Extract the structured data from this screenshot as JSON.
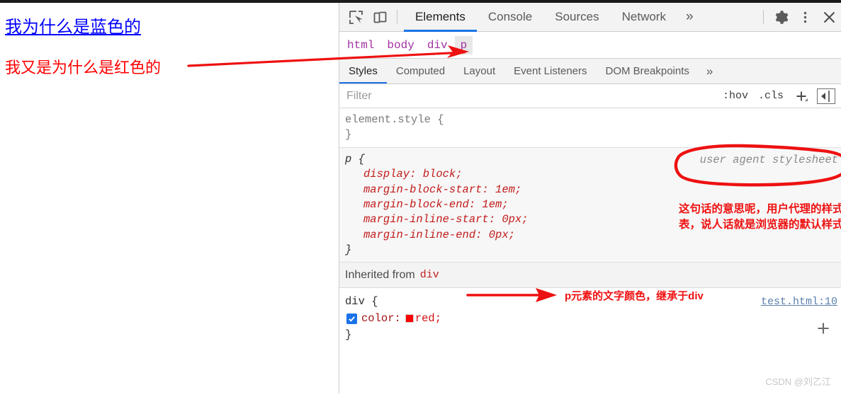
{
  "page": {
    "link_text": "我为什么是蓝色的",
    "paragraph_text": "我又是为什么是红色的",
    "link_color": "#0000ff",
    "paragraph_color": "#ff0000"
  },
  "devtools": {
    "toolbar": {
      "inspect_icon": "inspect-element-icon",
      "device_icon": "device-toolbar-icon",
      "settings_icon": "gear-icon",
      "menu_icon": "kebab-menu-icon",
      "close_icon": "close-icon",
      "more_label": "»",
      "tabs": [
        {
          "label": "Elements",
          "active": true
        },
        {
          "label": "Console",
          "active": false
        },
        {
          "label": "Sources",
          "active": false
        },
        {
          "label": "Network",
          "active": false
        }
      ]
    },
    "breadcrumb": {
      "items": [
        {
          "label": "html",
          "selected": false
        },
        {
          "label": "body",
          "selected": false
        },
        {
          "label": "div",
          "selected": false
        },
        {
          "label": "p",
          "selected": true
        }
      ]
    },
    "sidebar_tabs": {
      "items": [
        {
          "label": "Styles",
          "active": true
        },
        {
          "label": "Computed",
          "active": false
        },
        {
          "label": "Layout",
          "active": false
        },
        {
          "label": "Event Listeners",
          "active": false
        },
        {
          "label": "DOM Breakpoints",
          "active": false
        }
      ],
      "more_label": "»"
    },
    "filter_bar": {
      "placeholder": "Filter",
      "value": "",
      "hov_label": ":hov",
      "cls_label": ".cls",
      "new_rule_label": "+",
      "panel_toggle_label": "◀"
    },
    "styles": {
      "element_style": {
        "selector": "element.style {",
        "close": "}"
      },
      "p_rule": {
        "selector": "p {",
        "close": "}",
        "origin": "user agent stylesheet",
        "declarations": [
          "display: block;",
          "margin-block-start: 1em;",
          "margin-block-end: 1em;",
          "margin-inline-start: 0px;",
          "margin-inline-end: 0px;"
        ]
      },
      "inherited": {
        "label": "Inherited from",
        "tag": "div"
      },
      "div_rule": {
        "selector": "div {",
        "close": "}",
        "source": "test.html:10",
        "checkbox_checked": true,
        "property": "color:",
        "value": "red;",
        "swatch_color": "#ff0000",
        "add_rule_label": "+"
      }
    }
  },
  "annotations": {
    "ua_note": "这句话的意思呢，用户代理的样式表，说人话就是浏览器的默认样式",
    "inherit_note": "p元素的文字颜色，继承于div",
    "color": "#ee1111"
  },
  "watermark": "CSDN @刘乙江"
}
